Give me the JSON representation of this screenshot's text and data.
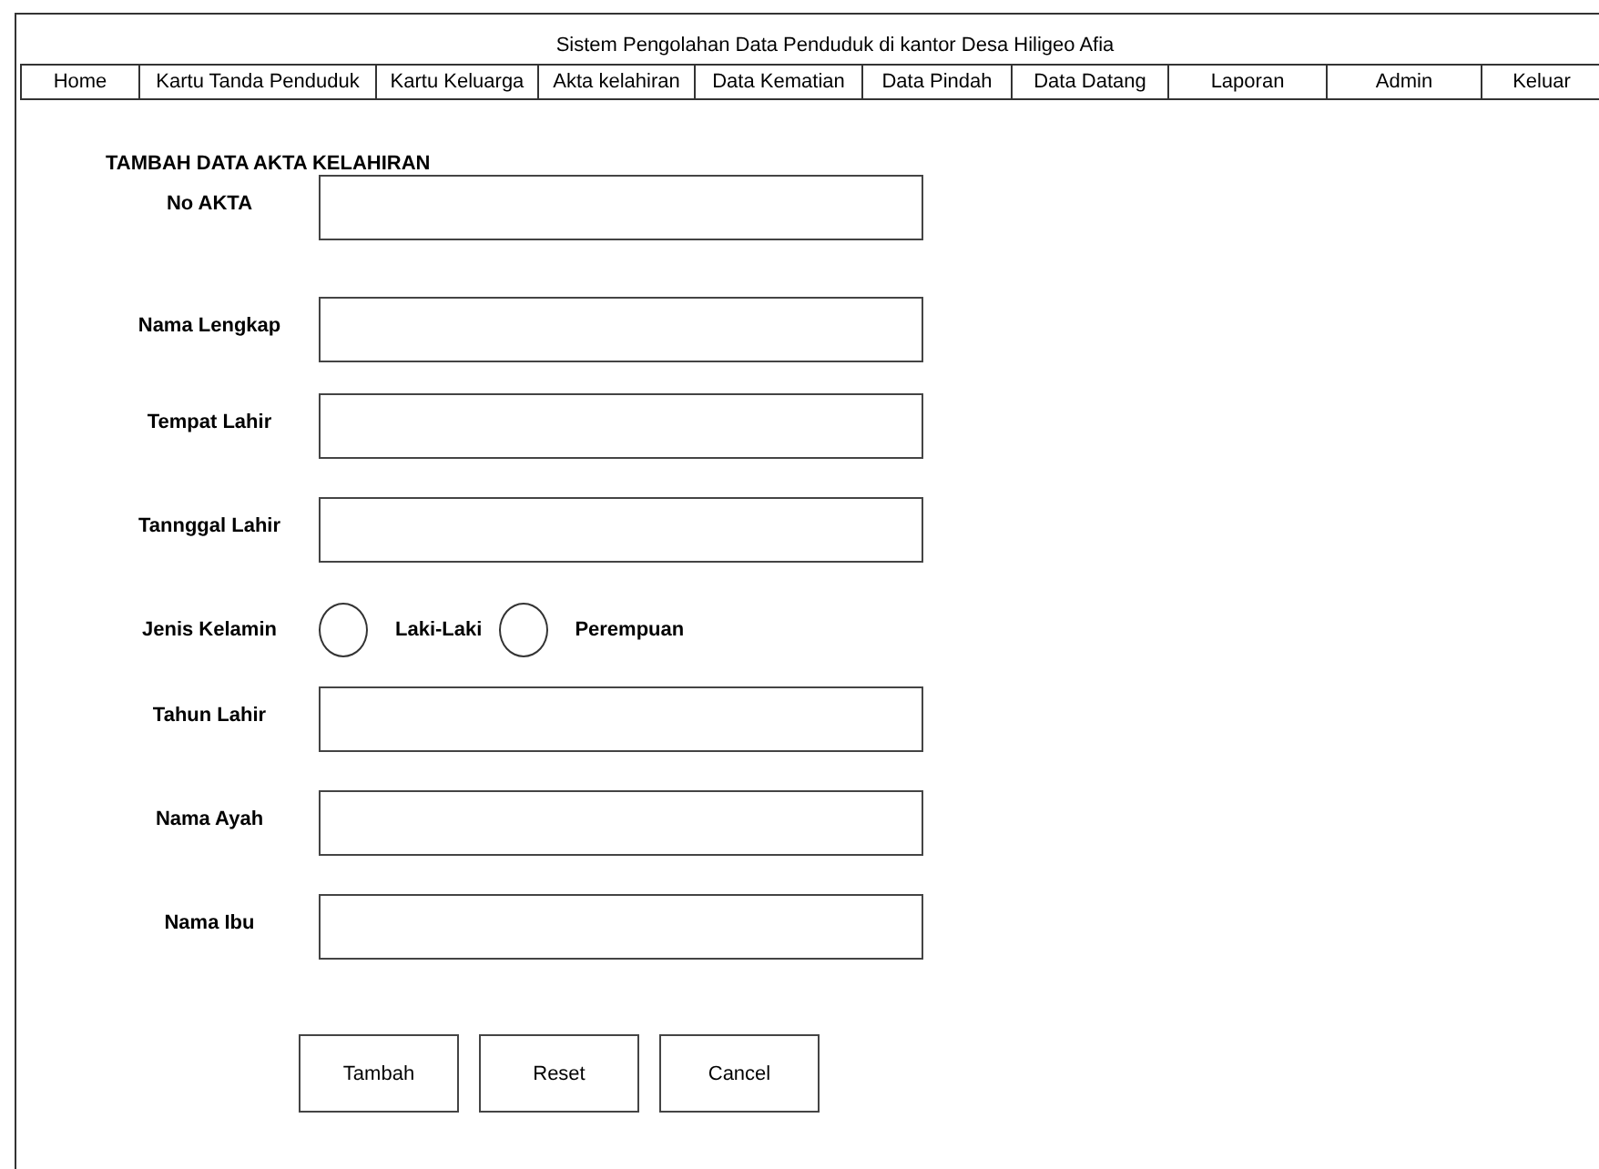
{
  "header": {
    "title": "Sistem Pengolahan Data Penduduk di kantor Desa Hiligeo Afia"
  },
  "nav": [
    {
      "label": "Home"
    },
    {
      "label": "Kartu Tanda Penduduk"
    },
    {
      "label": "Kartu Keluarga"
    },
    {
      "label": "Akta kelahiran"
    },
    {
      "label": "Data Kematian"
    },
    {
      "label": "Data Pindah"
    },
    {
      "label": "Data Datang"
    },
    {
      "label": "Laporan"
    },
    {
      "label": "Admin"
    },
    {
      "label": "Keluar"
    }
  ],
  "form": {
    "title": "TAMBAH DATA AKTA KELAHIRAN",
    "rows": [
      {
        "kind": "text",
        "label": "No AKTA"
      },
      {
        "kind": "text",
        "label": "Nama Lengkap"
      },
      {
        "kind": "text",
        "label": "Tempat Lahir"
      },
      {
        "kind": "text",
        "label": "Tannggal Lahir"
      },
      {
        "kind": "radio",
        "label": "Jenis Kelamin",
        "options": [
          {
            "label": "Laki-Laki",
            "selected": false
          },
          {
            "label": "Perempuan",
            "selected": false
          }
        ]
      },
      {
        "kind": "text",
        "label": "Tahun Lahir"
      },
      {
        "kind": "text",
        "label": "Nama Ayah"
      },
      {
        "kind": "text",
        "label": "Nama Ibu"
      }
    ],
    "buttons": [
      "Tambah",
      "Reset",
      "Cancel"
    ]
  }
}
